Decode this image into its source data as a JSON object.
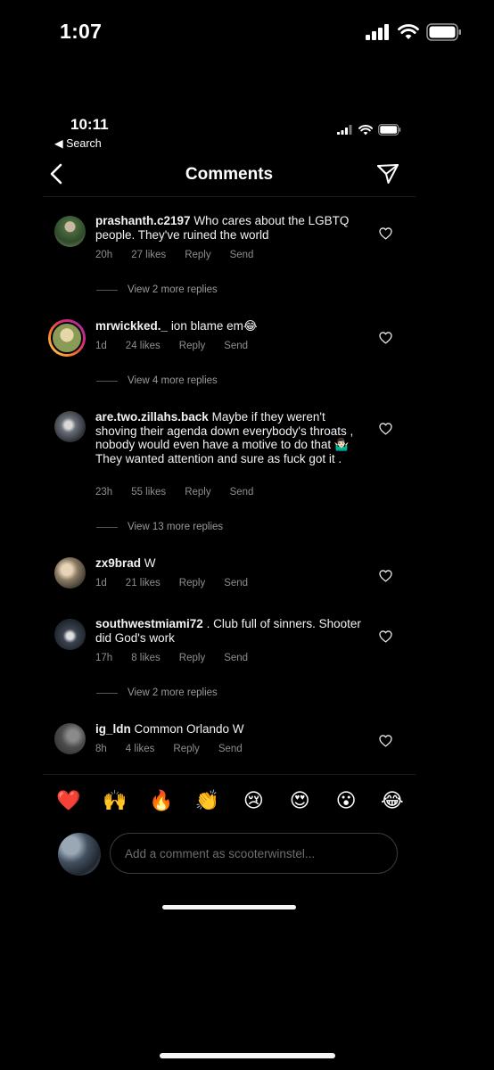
{
  "outer_status": {
    "time": "1:07"
  },
  "inner_status": {
    "time": "10:11",
    "back_label": "◀ Search"
  },
  "header": {
    "title": "Comments"
  },
  "comments": [
    {
      "user": "prashanth.c2197",
      "text": "Who cares about the LGBTQ people. They've ruined the world",
      "time": "20h",
      "likes": "27 likes",
      "reply": "Reply",
      "send": "Send",
      "more_replies": "View 2 more replies"
    },
    {
      "user": "mrwickked._",
      "text": "ion blame em😂",
      "time": "1d",
      "likes": "24 likes",
      "reply": "Reply",
      "send": "Send",
      "more_replies": "View 4 more replies"
    },
    {
      "user": "are.two.zillahs.back",
      "text": "Maybe if they weren't shoving their agenda down everybody's throats , nobody would even have a motive to do that 🤷🏻‍♂️ They wanted attention and sure as fuck got it .",
      "time": "23h",
      "likes": "55 likes",
      "reply": "Reply",
      "send": "Send",
      "more_replies": "View 13 more replies"
    },
    {
      "user": "zx9brad",
      "text": "W",
      "time": "1d",
      "likes": "21 likes",
      "reply": "Reply",
      "send": "Send"
    },
    {
      "user": "southwestmiami72",
      "text": ". Club full of sinners. Shooter did God's work",
      "time": "17h",
      "likes": "8 likes",
      "reply": "Reply",
      "send": "Send",
      "more_replies": "View 2 more replies"
    },
    {
      "user": "ig_ldn",
      "text": "Common Orlando W",
      "time": "8h",
      "likes": "4 likes",
      "reply": "Reply",
      "send": "Send"
    }
  ],
  "emoji_bar": [
    "❤️",
    "🙌",
    "🔥",
    "👏",
    "😢",
    "😍",
    "😮",
    "😂"
  ],
  "composer": {
    "placeholder": "Add a comment as scooterwinstel..."
  },
  "icons": {
    "signal": "cellular-signal-icon",
    "wifi": "wifi-icon",
    "battery": "battery-icon",
    "back": "chevron-left-icon",
    "direct": "paper-plane-icon",
    "like": "heart-outline-icon"
  }
}
